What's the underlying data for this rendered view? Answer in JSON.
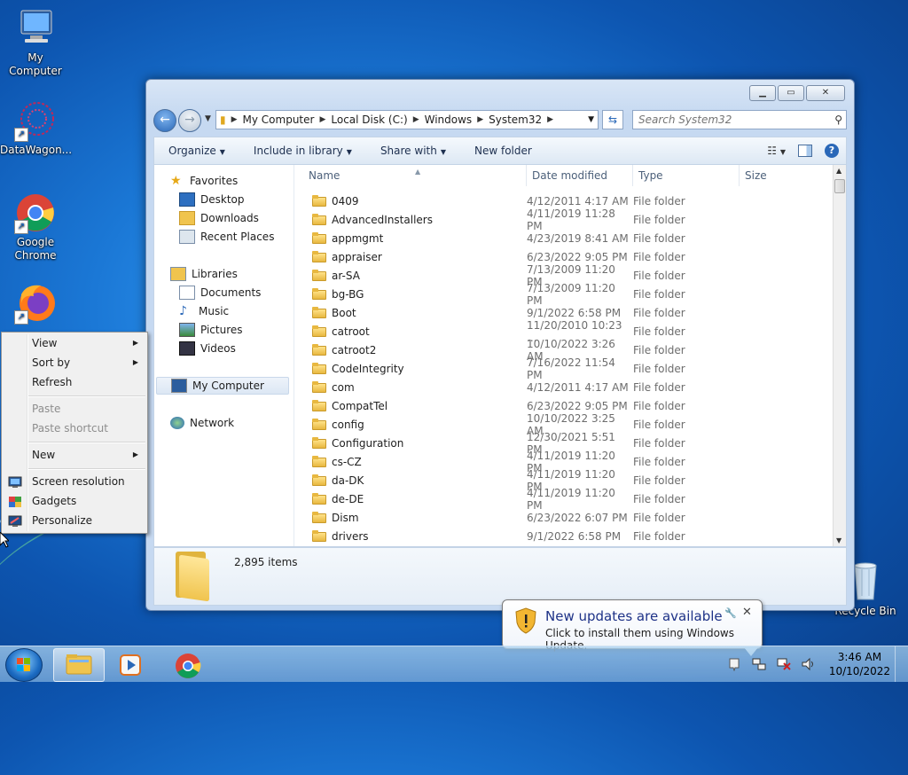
{
  "desktop": {
    "icons": [
      {
        "label": "My Computer"
      },
      {
        "label": "DataWagon..."
      },
      {
        "label": "Google Chrome"
      },
      {
        "label": "Recycle Bin"
      }
    ]
  },
  "window": {
    "address": {
      "crumbs": [
        "My Computer",
        "Local Disk (C:)",
        "Windows",
        "System32"
      ]
    },
    "search": {
      "placeholder": "Search System32"
    },
    "toolbar": {
      "organize": "Organize",
      "include": "Include in library",
      "share": "Share with",
      "new_folder": "New folder"
    },
    "nav": {
      "favorites": "Favorites",
      "desktop": "Desktop",
      "downloads": "Downloads",
      "recent": "Recent Places",
      "libraries": "Libraries",
      "documents": "Documents",
      "music": "Music",
      "pictures": "Pictures",
      "videos": "Videos",
      "my_computer": "My Computer",
      "network": "Network"
    },
    "columns": {
      "name": "Name",
      "date": "Date modified",
      "type": "Type",
      "size": "Size"
    },
    "files": [
      {
        "name": "0409",
        "date": "4/12/2011 4:17 AM",
        "type": "File folder"
      },
      {
        "name": "AdvancedInstallers",
        "date": "4/11/2019 11:28 PM",
        "type": "File folder"
      },
      {
        "name": "appmgmt",
        "date": "4/23/2019 8:41 AM",
        "type": "File folder"
      },
      {
        "name": "appraiser",
        "date": "6/23/2022 9:05 PM",
        "type": "File folder"
      },
      {
        "name": "ar-SA",
        "date": "7/13/2009 11:20 PM",
        "type": "File folder"
      },
      {
        "name": "bg-BG",
        "date": "7/13/2009 11:20 PM",
        "type": "File folder"
      },
      {
        "name": "Boot",
        "date": "9/1/2022 6:58 PM",
        "type": "File folder"
      },
      {
        "name": "catroot",
        "date": "11/20/2010 10:23 ...",
        "type": "File folder"
      },
      {
        "name": "catroot2",
        "date": "10/10/2022 3:26 AM",
        "type": "File folder"
      },
      {
        "name": "CodeIntegrity",
        "date": "7/16/2022 11:54 PM",
        "type": "File folder"
      },
      {
        "name": "com",
        "date": "4/12/2011 4:17 AM",
        "type": "File folder"
      },
      {
        "name": "CompatTel",
        "date": "6/23/2022 9:05 PM",
        "type": "File folder"
      },
      {
        "name": "config",
        "date": "10/10/2022 3:25 AM",
        "type": "File folder"
      },
      {
        "name": "Configuration",
        "date": "12/30/2021 5:51 PM",
        "type": "File folder"
      },
      {
        "name": "cs-CZ",
        "date": "4/11/2019 11:20 PM",
        "type": "File folder"
      },
      {
        "name": "da-DK",
        "date": "4/11/2019 11:20 PM",
        "type": "File folder"
      },
      {
        "name": "de-DE",
        "date": "4/11/2019 11:20 PM",
        "type": "File folder"
      },
      {
        "name": "Dism",
        "date": "6/23/2022 6:07 PM",
        "type": "File folder"
      },
      {
        "name": "drivers",
        "date": "9/1/2022 6:58 PM",
        "type": "File folder"
      }
    ],
    "details": {
      "count": "2,895 items"
    }
  },
  "context_menu": {
    "view": "View",
    "sort_by": "Sort by",
    "refresh": "Refresh",
    "paste": "Paste",
    "paste_shortcut": "Paste shortcut",
    "new": "New",
    "screen_resolution": "Screen resolution",
    "gadgets": "Gadgets",
    "personalize": "Personalize"
  },
  "balloon": {
    "title": "New updates are available",
    "body": "Click to install them using Windows Update."
  },
  "taskbar": {
    "time": "3:46 AM",
    "date": "10/10/2022"
  },
  "colors": {
    "accent": "#2a68b8",
    "wallpaper": "#1b78d6"
  }
}
